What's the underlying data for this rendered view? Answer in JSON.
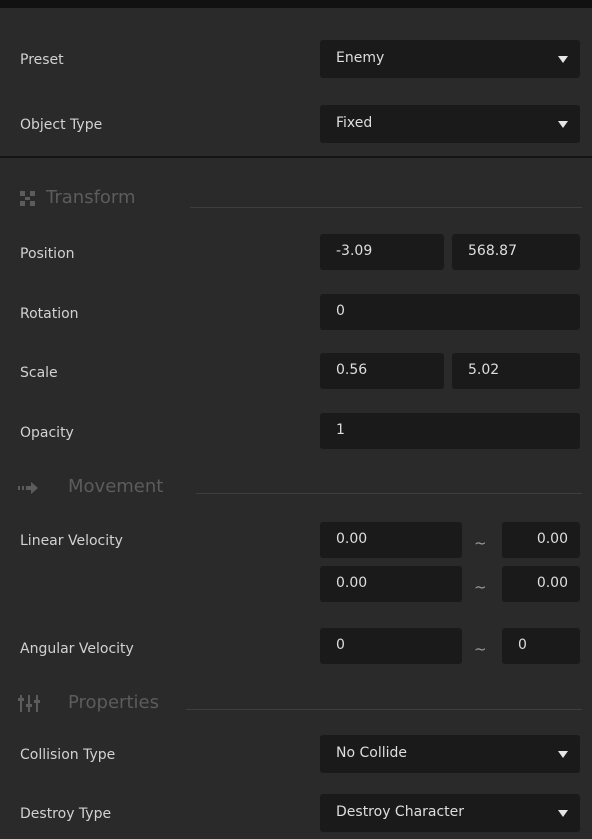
{
  "preset": {
    "label": "Preset",
    "value": "Enemy"
  },
  "object_type": {
    "label": "Object Type",
    "value": "Fixed"
  },
  "transform": {
    "title": "Transform",
    "icon": "transform-grid-icon",
    "position": {
      "label": "Position",
      "x": "-3.09",
      "y": "568.87"
    },
    "rotation": {
      "label": "Rotation",
      "value": "0"
    },
    "scale": {
      "label": "Scale",
      "x": "0.56",
      "y": "5.02"
    },
    "opacity": {
      "label": "Opacity",
      "value": "1"
    }
  },
  "movement": {
    "title": "Movement",
    "icon": "arrow-right-icon",
    "linear_velocity": {
      "label": "Linear Velocity",
      "x_min": "0.00",
      "x_max": "0.00",
      "y_min": "0.00",
      "y_max": "0.00"
    },
    "angular_velocity": {
      "label": "Angular Velocity",
      "min": "0",
      "max": "0"
    },
    "range_symbol": "~"
  },
  "properties": {
    "title": "Properties",
    "icon": "sliders-icon",
    "collision_type": {
      "label": "Collision Type",
      "value": "No Collide"
    },
    "destroy_type": {
      "label": "Destroy Type",
      "value": "Destroy Character"
    }
  },
  "colors": {
    "background": "#2a2a2a",
    "field": "#1a1a1a",
    "section_text": "#5c5c5c"
  }
}
